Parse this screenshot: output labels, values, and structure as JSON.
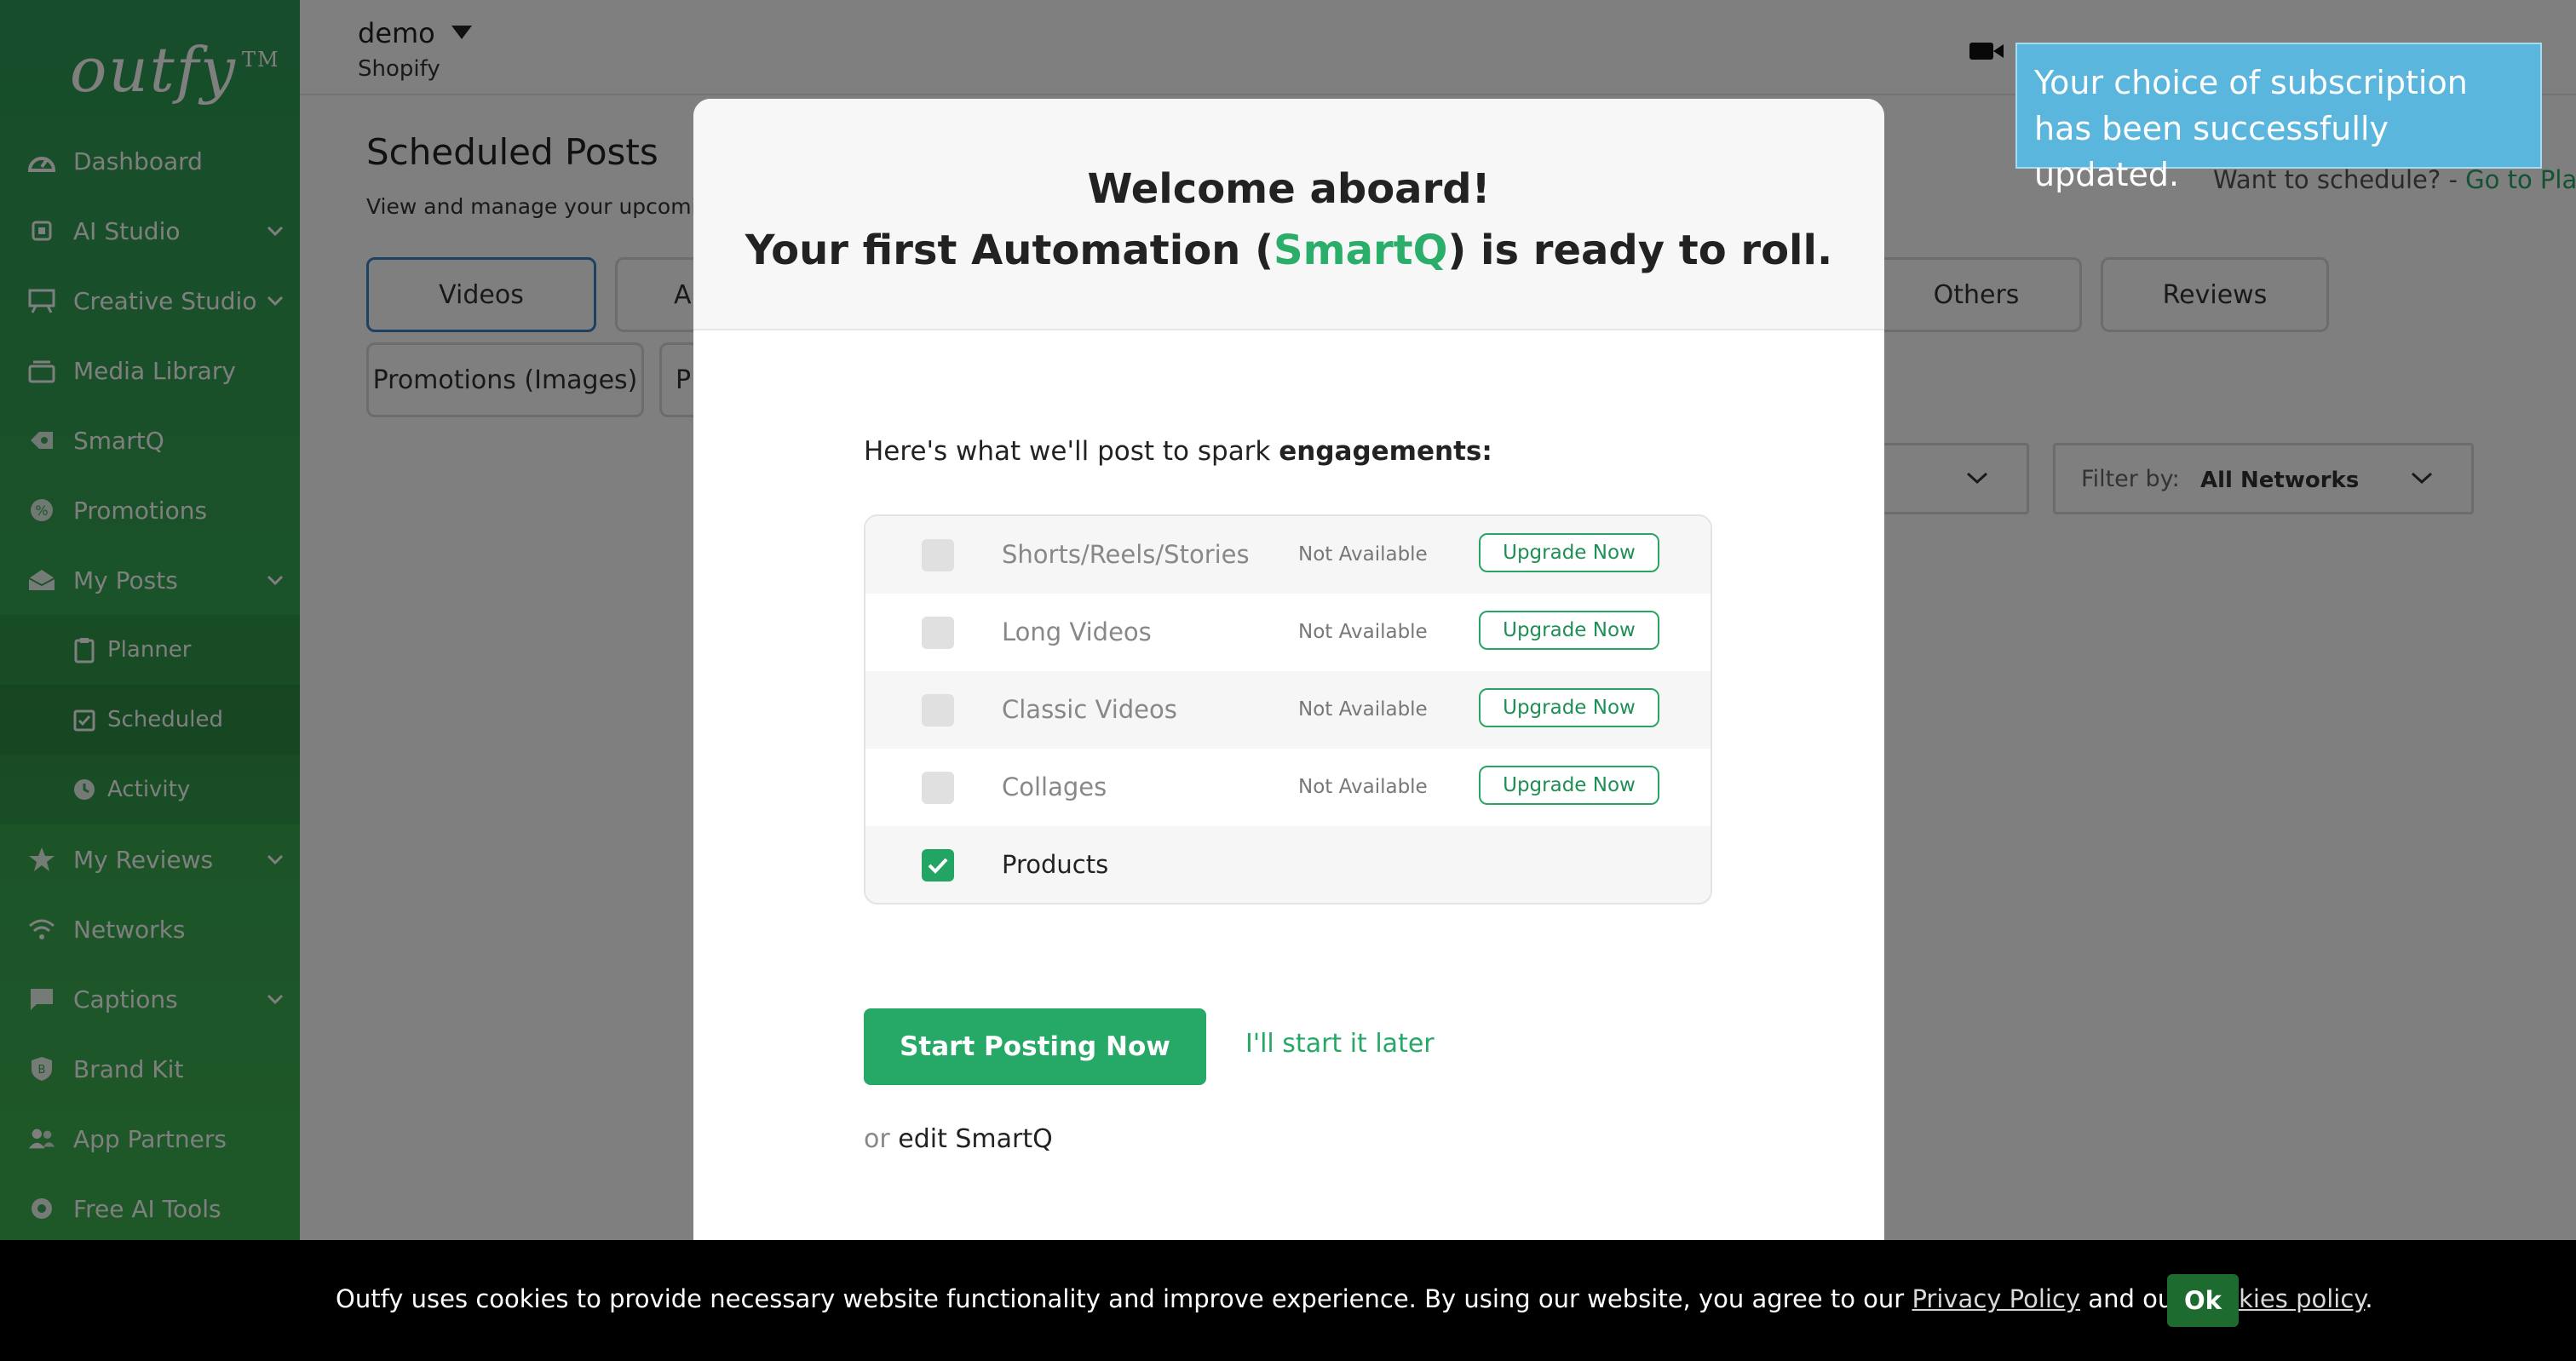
{
  "sidebar": {
    "logo": "outfy",
    "logo_tm": "TM",
    "items": [
      {
        "label": "Dashboard"
      },
      {
        "label": "AI Studio"
      },
      {
        "label": "Creative Studio"
      },
      {
        "label": "Media Library"
      },
      {
        "label": "SmartQ"
      },
      {
        "label": "Promotions"
      },
      {
        "label": "My Posts"
      },
      {
        "label": "Planner"
      },
      {
        "label": "Scheduled"
      },
      {
        "label": "Activity"
      },
      {
        "label": "My Reviews"
      },
      {
        "label": "Networks"
      },
      {
        "label": "Captions"
      },
      {
        "label": "Brand Kit"
      },
      {
        "label": "App Partners"
      },
      {
        "label": "Free AI Tools"
      }
    ]
  },
  "header": {
    "account_name": "demo",
    "account_platform": "Shopify"
  },
  "page": {
    "title": "Scheduled Posts",
    "subtitle": "View and manage your upcomi",
    "want_schedule": "Want to schedule? - ",
    "go_to_planner": "Go to Plann",
    "tabs": [
      "Videos",
      "Al",
      "Others",
      "Reviews",
      "Promotions (Images)",
      "P"
    ],
    "filter_label": "Filter by:",
    "filter_value": "All Networks"
  },
  "modal": {
    "title_line1": "Welcome aboard!",
    "title_line2_prefix": "Your first Automation (",
    "title_line2_accent": "SmartQ",
    "title_line2_suffix": ") is ready to roll.",
    "intro_text": "Here's what we'll post to spark ",
    "intro_bold": "engagements:",
    "options": [
      {
        "label": "Shorts/Reels/Stories",
        "status": "Not Available",
        "action": "Upgrade Now"
      },
      {
        "label": "Long Videos",
        "status": "Not Available",
        "action": "Upgrade Now"
      },
      {
        "label": "Classic Videos",
        "status": "Not Available",
        "action": "Upgrade Now"
      },
      {
        "label": "Collages",
        "status": "Not Available",
        "action": "Upgrade Now"
      },
      {
        "label": "Products"
      }
    ],
    "start_button": "Start Posting Now",
    "later_link": "I'll start it later",
    "or_text": "or ",
    "edit_link": "edit SmartQ"
  },
  "toast": {
    "message": "Your choice of subscription has been successfully updated."
  },
  "cookie": {
    "text": "Outfy uses cookies to provide necessary website functionality and improve experience. By using our website, you agree to our ",
    "privacy": "Privacy Policy",
    "and_our": " and our ",
    "cookies_policy": "Cookies policy",
    "period": ".",
    "ok": "Ok"
  },
  "colors": {
    "brand_green": "#2aa464",
    "toast_blue": "#5bb6dd",
    "active_tab_border": "#3b82c4"
  }
}
